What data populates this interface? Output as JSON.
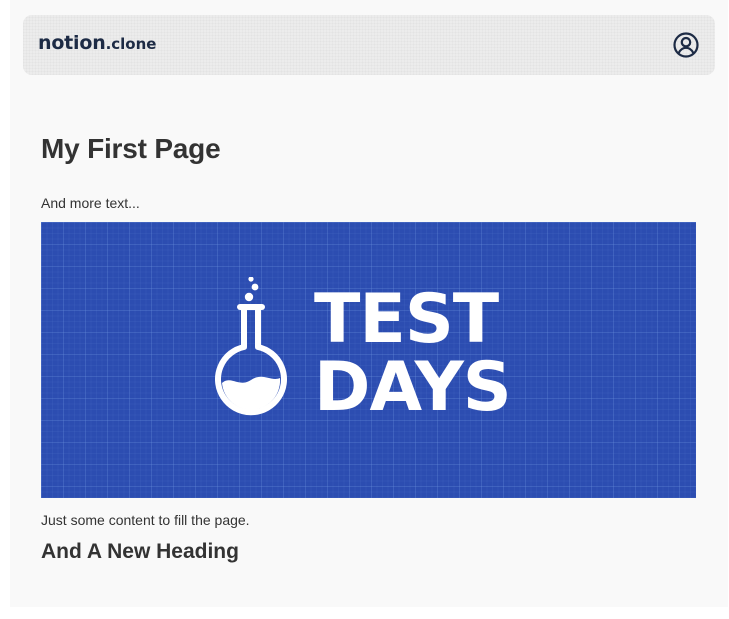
{
  "app": {
    "brand_main": "notion",
    "brand_sub": ".clone"
  },
  "header": {
    "user_icon": "user-circle-icon"
  },
  "content": {
    "title": "My First Page",
    "paragraph_1": "And more text...",
    "banner": {
      "line_1": "TEST",
      "line_2": "DAYS",
      "icon": "flask-icon",
      "background_color": "#2c4db1"
    },
    "paragraph_2": "Just some content to fill the page.",
    "heading_2": "And A New Heading"
  },
  "colors": {
    "brand_text": "#1d2b45",
    "body_text": "#333333",
    "topbar_bg": "#ececec"
  }
}
